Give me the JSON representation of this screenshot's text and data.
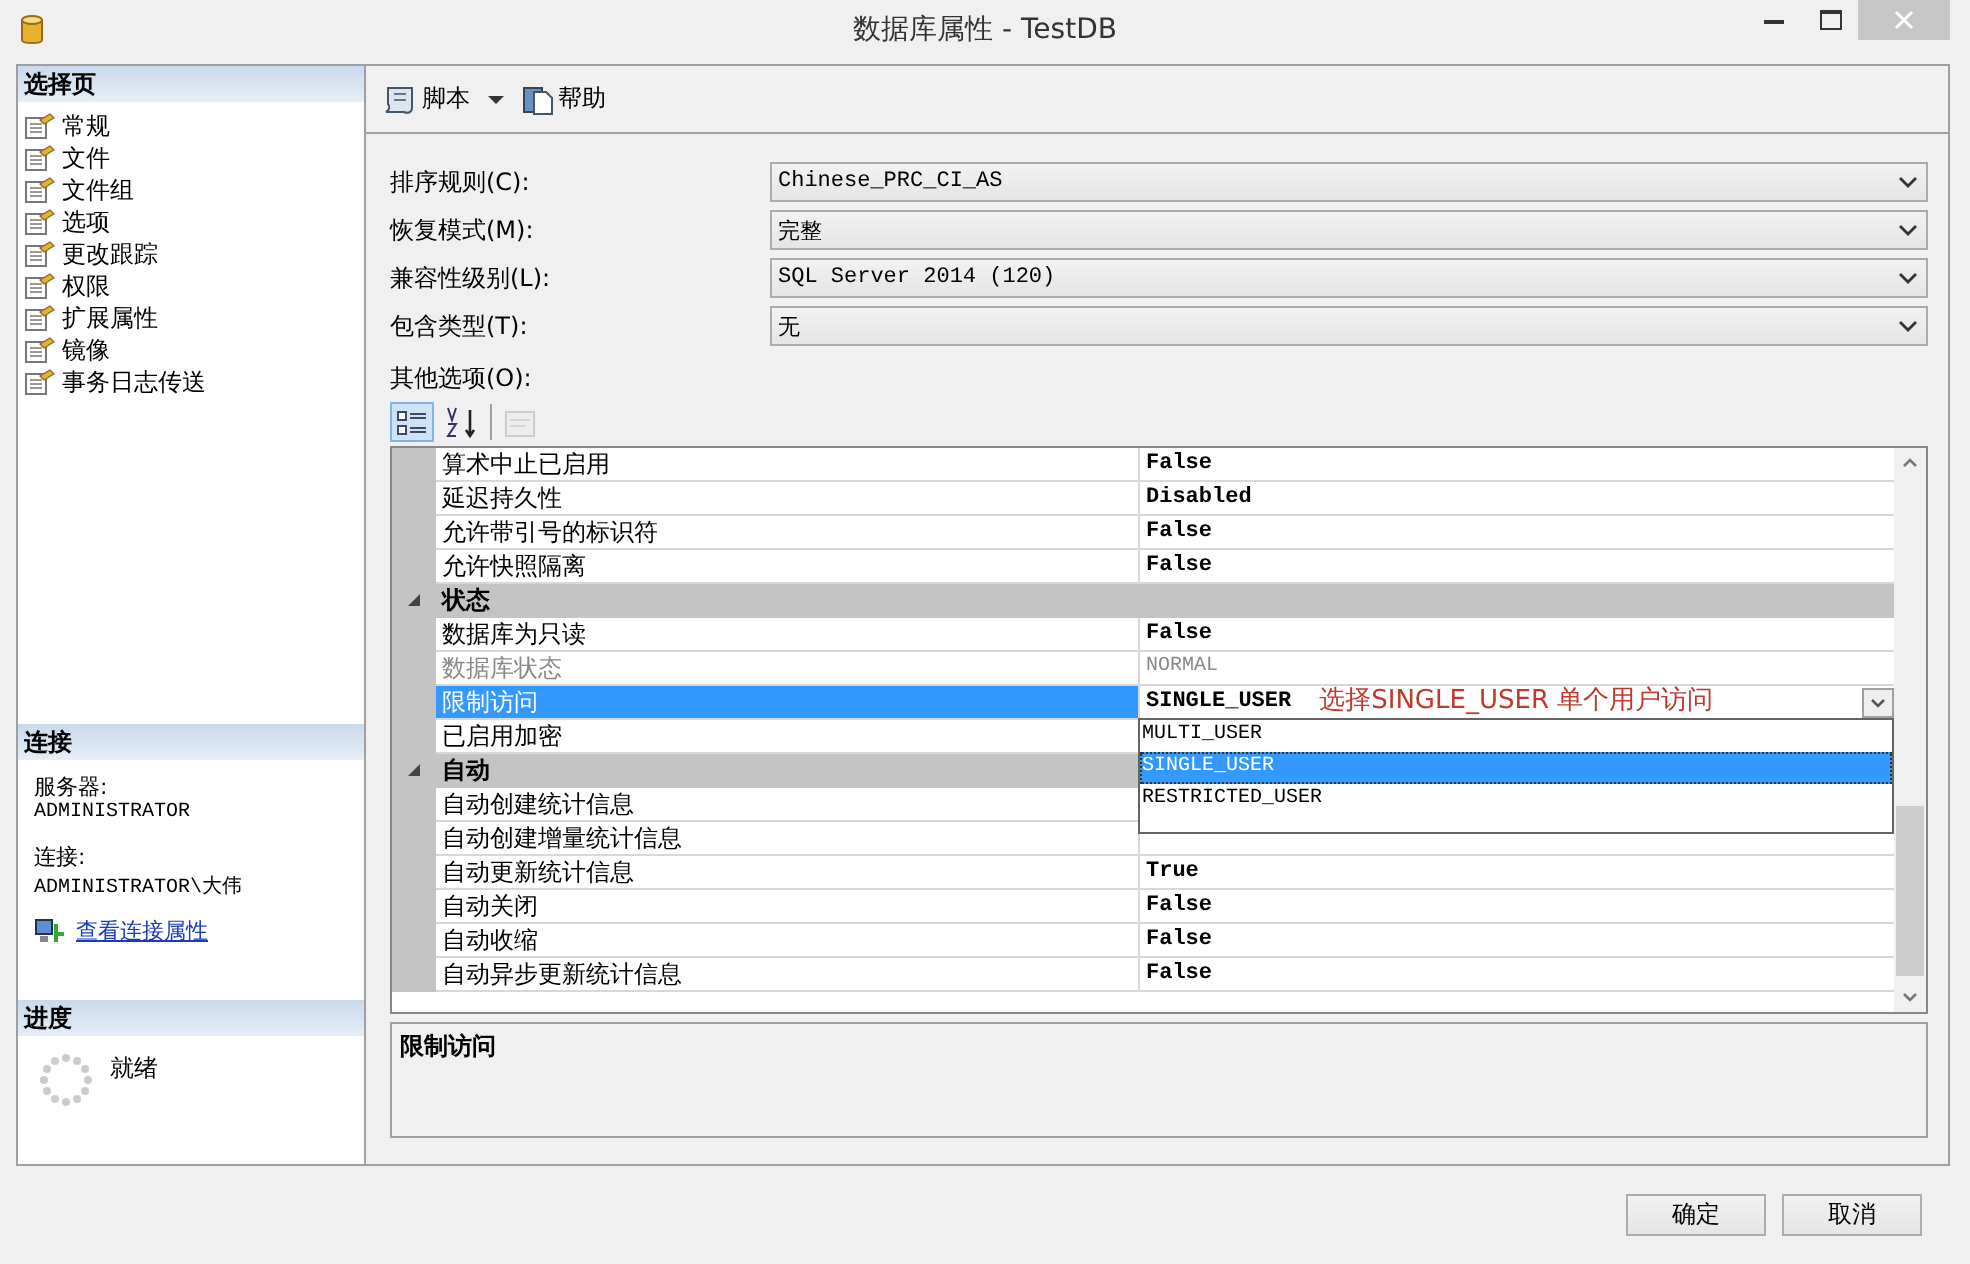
{
  "window": {
    "title": "数据库属性 - TestDB"
  },
  "sidebar": {
    "header": "选择页",
    "items": [
      {
        "label": "常规"
      },
      {
        "label": "文件"
      },
      {
        "label": "文件组"
      },
      {
        "label": "选项"
      },
      {
        "label": "更改跟踪"
      },
      {
        "label": "权限"
      },
      {
        "label": "扩展属性"
      },
      {
        "label": "镜像"
      },
      {
        "label": "事务日志传送"
      }
    ],
    "connection": {
      "header": "连接",
      "server_label": "服务器:",
      "server": "ADMINISTRATOR",
      "connection_label": "连接:",
      "connection": "ADMINISTRATOR\\大伟",
      "link": "查看连接属性"
    },
    "progress": {
      "header": "进度",
      "status": "就绪"
    }
  },
  "toolbar": {
    "script": "脚本",
    "help": "帮助"
  },
  "fields": [
    {
      "label": "排序规则(C):",
      "value": "Chinese_PRC_CI_AS"
    },
    {
      "label": "恢复模式(M):",
      "value": "完整"
    },
    {
      "label": "兼容性级别(L):",
      "value": "SQL Server 2014 (120)"
    },
    {
      "label": "包含类型(T):",
      "value": "无"
    }
  ],
  "other_options_label": "其他选项(O):",
  "grid_tools": [
    {
      "kind": "categorized",
      "selected": true,
      "disabled": false
    },
    {
      "kind": "alphabetical",
      "selected": false,
      "disabled": false
    },
    {
      "kind": "pages",
      "selected": false,
      "disabled": true
    }
  ],
  "rows": [
    {
      "kind": "property",
      "name": "算术中止已启用",
      "value": "False",
      "selected": false,
      "disabled": false
    },
    {
      "kind": "property",
      "name": "延迟持久性",
      "value": "Disabled",
      "selected": false,
      "disabled": false
    },
    {
      "kind": "property",
      "name": "允许带引号的标识符",
      "value": "False",
      "selected": false,
      "disabled": false
    },
    {
      "kind": "property",
      "name": "允许快照隔离",
      "value": "False",
      "selected": false,
      "disabled": false
    },
    {
      "kind": "category",
      "name": "状态",
      "expanded": true
    },
    {
      "kind": "property",
      "name": "数据库为只读",
      "value": "False",
      "selected": false,
      "disabled": false
    },
    {
      "kind": "property",
      "name": "数据库状态",
      "value": "NORMAL",
      "selected": false,
      "disabled": true
    },
    {
      "kind": "property",
      "name": "限制访问",
      "value": "SINGLE_USER",
      "selected": true,
      "disabled": false,
      "annotation": "选择SINGLE_USER 单个用户访问",
      "options": [
        {
          "label": "MULTI_USER",
          "selected": false
        },
        {
          "label": "SINGLE_USER",
          "selected": true
        },
        {
          "label": "RESTRICTED_USER",
          "selected": false
        }
      ]
    },
    {
      "kind": "property",
      "name": "已启用加密",
      "selected": false,
      "disabled": false
    },
    {
      "kind": "category",
      "name": "自动",
      "expanded": true
    },
    {
      "kind": "property",
      "name": "自动创建统计信息",
      "selected": false,
      "disabled": false
    },
    {
      "kind": "property",
      "name": "自动创建增量统计信息",
      "selected": false,
      "disabled": false
    },
    {
      "kind": "property",
      "name": "自动更新统计信息",
      "value": "True",
      "selected": false,
      "disabled": false
    },
    {
      "kind": "property",
      "name": "自动关闭",
      "value": "False",
      "selected": false,
      "disabled": false
    },
    {
      "kind": "property",
      "name": "自动收缩",
      "value": "False",
      "selected": false,
      "disabled": false
    },
    {
      "kind": "property",
      "name": "自动异步更新统计信息",
      "value": "False",
      "selected": false,
      "disabled": false
    }
  ],
  "description": {
    "title": "限制访问"
  },
  "buttons": [
    "确定",
    "取消"
  ]
}
